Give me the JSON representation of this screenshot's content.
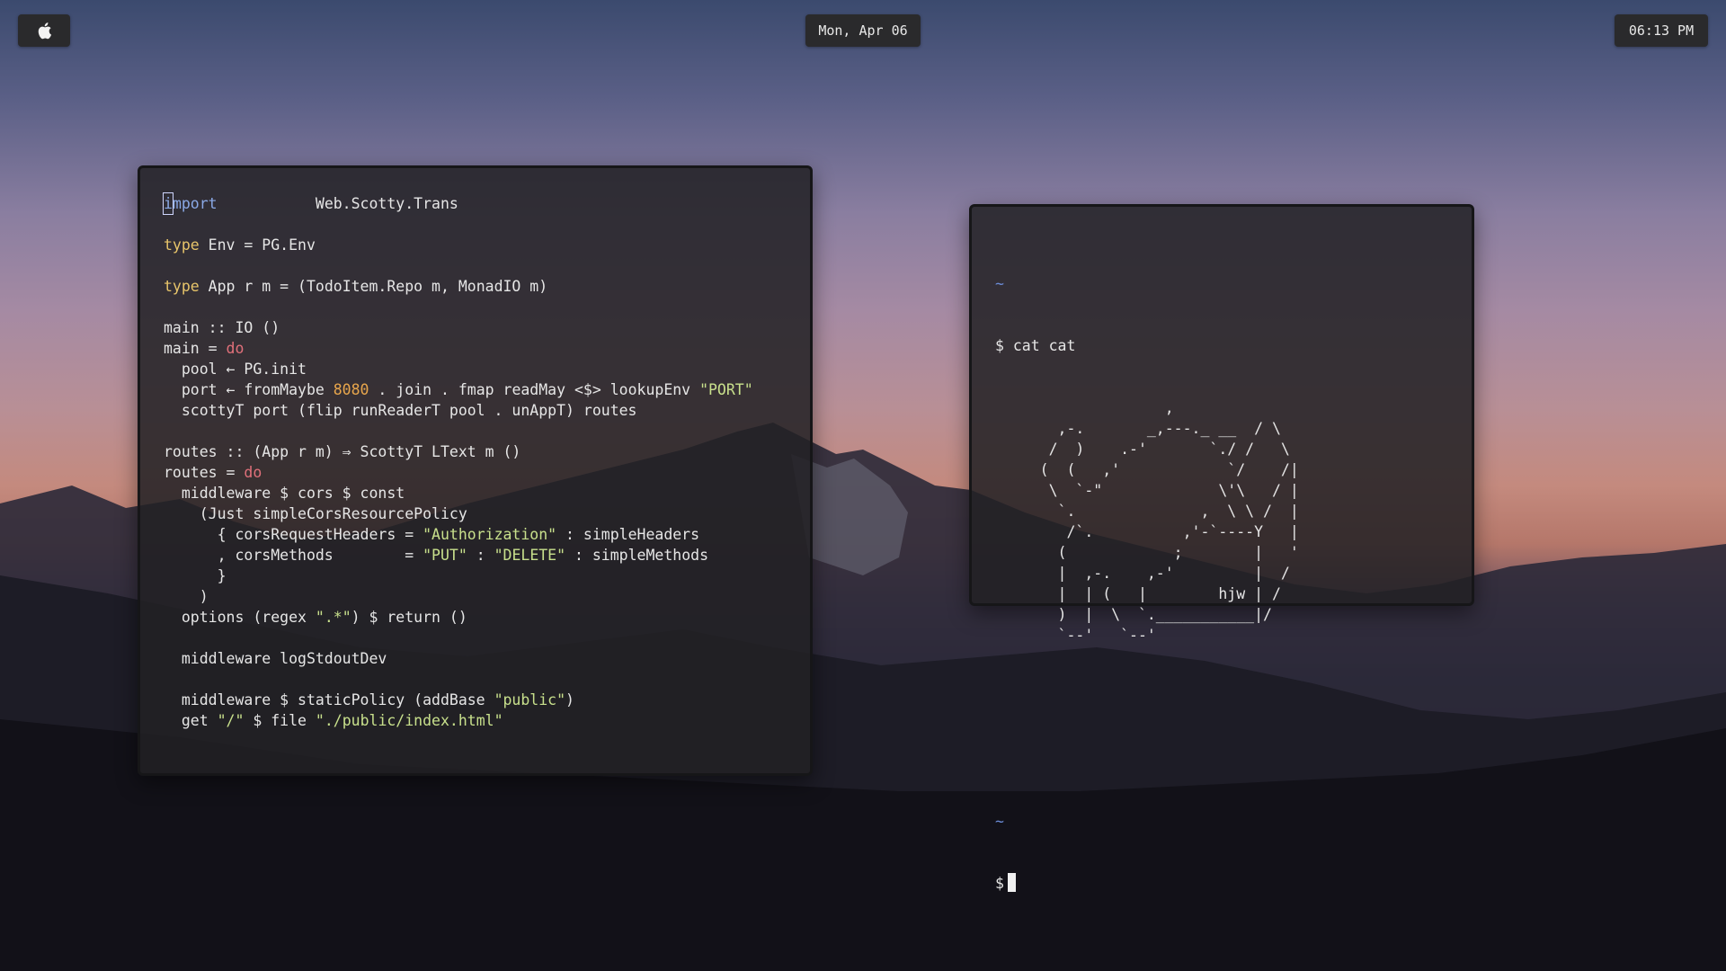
{
  "topbar": {
    "date": "Mon, Apr 06",
    "time": "06:13 PM",
    "logo_icon": "apple-icon"
  },
  "editor": {
    "lines": [
      [
        {
          "t": "i",
          "c": "cursor"
        },
        {
          "t": "mport",
          "c": "kw-b"
        },
        {
          "t": "           Web.Scotty.Trans"
        }
      ],
      [],
      [
        {
          "t": "type",
          "c": "kw-y"
        },
        {
          "t": " Env = PG.Env"
        }
      ],
      [],
      [
        {
          "t": "type",
          "c": "kw-y"
        },
        {
          "t": " App r m = (TodoItem.Repo m, MonadIO m)"
        }
      ],
      [],
      [
        {
          "t": "main :: IO ()"
        }
      ],
      [
        {
          "t": "main = "
        },
        {
          "t": "do",
          "c": "kw-r"
        }
      ],
      [
        {
          "t": "  pool ← PG.init"
        }
      ],
      [
        {
          "t": "  port ← fromMaybe "
        },
        {
          "t": "8080",
          "c": "num"
        },
        {
          "t": " . join . fmap readMay <$> lookupEnv "
        },
        {
          "t": "\"PORT\"",
          "c": "str"
        }
      ],
      [
        {
          "t": "  scottyT port (flip runReaderT pool . unAppT) routes"
        }
      ],
      [],
      [
        {
          "t": "routes :: (App r m) ⇒ ScottyT LText m ()"
        }
      ],
      [
        {
          "t": "routes = "
        },
        {
          "t": "do",
          "c": "kw-r"
        }
      ],
      [
        {
          "t": "  middleware $ cors $ const"
        }
      ],
      [
        {
          "t": "    (Just simpleCorsResourcePolicy"
        }
      ],
      [
        {
          "t": "      { corsRequestHeaders = "
        },
        {
          "t": "\"Authorization\"",
          "c": "str"
        },
        {
          "t": " : simpleHeaders"
        }
      ],
      [
        {
          "t": "      , corsMethods        = "
        },
        {
          "t": "\"PUT\"",
          "c": "str"
        },
        {
          "t": " : "
        },
        {
          "t": "\"DELETE\"",
          "c": "str"
        },
        {
          "t": " : simpleMethods"
        }
      ],
      [
        {
          "t": "      }"
        }
      ],
      [
        {
          "t": "    )"
        }
      ],
      [
        {
          "t": "  options (regex "
        },
        {
          "t": "\".*\"",
          "c": "str"
        },
        {
          "t": ") $ return ()"
        }
      ],
      [],
      [
        {
          "t": "  middleware logStdoutDev"
        }
      ],
      [],
      [
        {
          "t": "  middleware $ staticPolicy (addBase "
        },
        {
          "t": "\"public\"",
          "c": "str"
        },
        {
          "t": ")"
        }
      ],
      [
        {
          "t": "  get "
        },
        {
          "t": "\"/\"",
          "c": "str"
        },
        {
          "t": " $ file "
        },
        {
          "t": "\"./public/index.html\"",
          "c": "str"
        }
      ]
    ]
  },
  "terminal": {
    "tilde": "~",
    "command": "$ cat cat",
    "ascii_art": "                   ,\n       ,-.       _,---._ __  / \\\n      /  )    .-'       `./ /   \\\n     (  (   ,'            `/    /|\n      \\  `-\"             \\'\\   / |\n       `.              ,  \\ \\ /  |\n        /`.          ,'-`----Y   |\n       (            ;        |   '\n       |  ,-.    ,-'         |  /\n       |  | (   |        hjw | /\n       )  |  \\  `.___________|/\n       `--'   `--'",
    "prompt_tilde": "~",
    "prompt": "$"
  }
}
